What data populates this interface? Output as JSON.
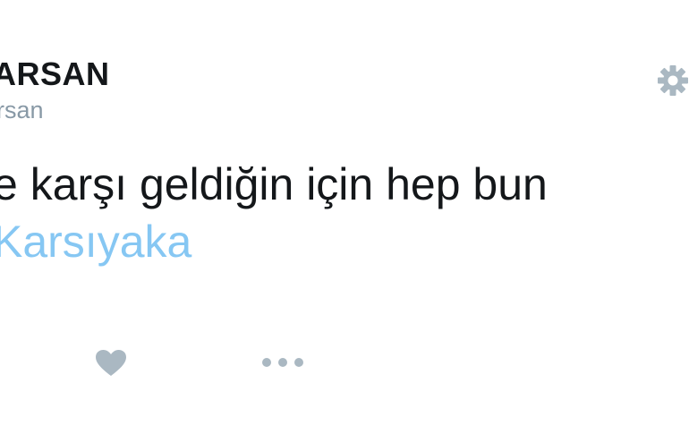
{
  "tweet": {
    "display_name": "ARSAN",
    "handle": "rsan",
    "text": "e karşı geldiğin için hep bun",
    "hashtag": "Karsıyaka"
  },
  "icons": {
    "settings": "gear-icon",
    "like": "heart-icon",
    "more": "more-dots-icon"
  },
  "colors": {
    "text": "#14171a",
    "handle": "#8899a6",
    "hashtag": "#86c7f3",
    "icon": "#aab8c2"
  }
}
